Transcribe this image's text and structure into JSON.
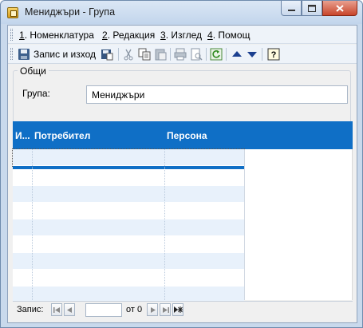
{
  "window": {
    "title": "Мениджъри - Група"
  },
  "menu": [
    {
      "num": "1",
      "label": ". Номенклатура"
    },
    {
      "num": "2",
      "label": ". Редакция"
    },
    {
      "num": "3",
      "label": ". Изглед"
    },
    {
      "num": "4",
      "label": ". Помощ"
    }
  ],
  "toolbar": {
    "save_exit_label": "Запис и изход",
    "icons": [
      "save-exit-icon",
      "save-as-icon",
      "cut-icon",
      "copy-icon",
      "paste-icon",
      "print-icon",
      "print-preview-icon",
      "refresh-icon",
      "move-up-icon",
      "move-down-icon",
      "help-icon"
    ]
  },
  "group": {
    "legend": "Общи",
    "field_label": "Група:",
    "field_value": "Мениджъри"
  },
  "grid": {
    "columns": [
      "И...",
      "Потребител",
      "Персона"
    ],
    "rows": []
  },
  "navigator": {
    "label": "Запис:",
    "current": "",
    "of_text": "от 0"
  },
  "colors": {
    "header_bg": "#0f6fc6",
    "alt_row": "#e8f1fb",
    "titlebar": "#c9d9ec"
  }
}
